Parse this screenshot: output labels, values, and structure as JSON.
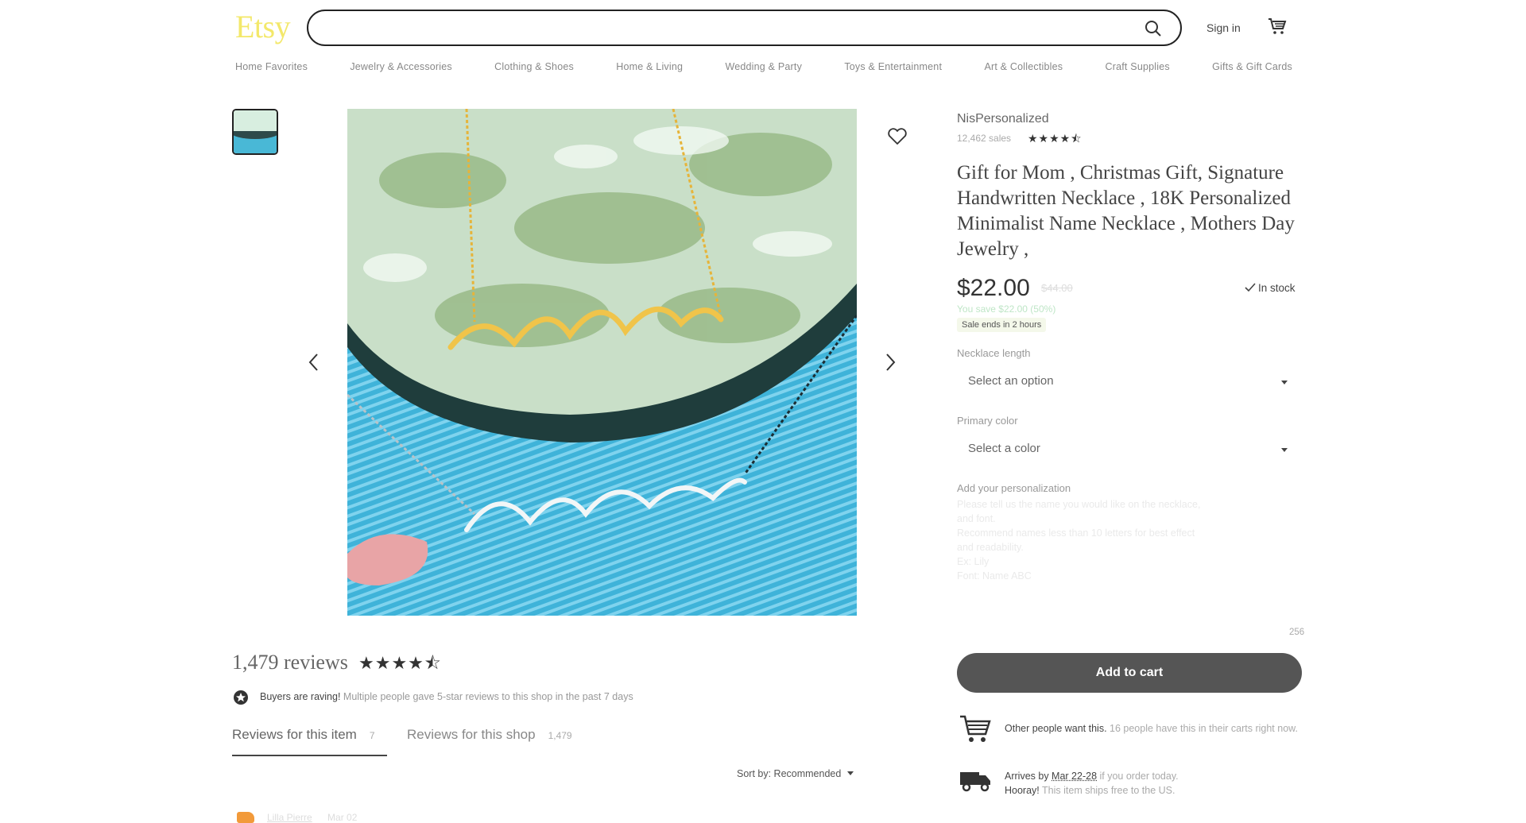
{
  "header": {
    "logo": "Etsy",
    "search_placeholder": "",
    "sign_in": "Sign in",
    "nav": [
      "Home Favorites",
      "Jewelry & Accessories",
      "Clothing & Shoes",
      "Home & Living",
      "Wedding & Party",
      "Toys & Entertainment",
      "Art & Collectibles",
      "Craft Supplies",
      "Gifts & Gift Cards"
    ]
  },
  "listing": {
    "shop_name": "NisPersonalized",
    "sales": "12,462 sales",
    "shop_rating": "★★★★⯪",
    "title": "Gift for Mom , Christmas Gift, Signature Handwritten Necklace , 18K Personalized Minimalist Name Necklace , Mothers Day Jewelry ,",
    "price": "$22.00",
    "original_price": "$44.00",
    "stock": "In stock",
    "savings": "You save $22.00 (50%)",
    "sale_badge": "Sale ends in 2 hours",
    "option1_label": "Necklace length",
    "option1_value": "Select an option",
    "option2_label": "Primary color",
    "option2_value": "Select a color",
    "personalization_label": "Add your personalization",
    "personalization_lines": [
      "Please tell us the name you would like on the necklace,",
      "and font.",
      "Recommend names less than 10 letters for best effect",
      "and readability.",
      "Ex: Lily",
      "Font: Name ABC"
    ],
    "char_count": "256",
    "add_to_cart": "Add to cart",
    "demand_bold": "Other people want this.",
    "demand_text": " 16 people have this in their carts right now.",
    "arrives_prefix": "Arrives by ",
    "arrives_date": "Mar 22-28",
    "arrives_suffix": " if you order today.",
    "shipping_bold": "Hooray!",
    "shipping_text": " This item ships free to the US."
  },
  "reviews": {
    "count_title": "1,479 reviews",
    "stars": "★★★★⯪",
    "raving_bold": "Buyers are raving!",
    "raving_text": " Multiple people gave 5-star reviews to this shop in the past 7 days",
    "tab_item_label": "Reviews for this item",
    "tab_item_count": "7",
    "tab_shop_label": "Reviews for this shop",
    "tab_shop_count": "1,479",
    "sort_label": "Sort by: Recommended",
    "first_reviewer": "Lilla Pierre",
    "first_date": "Mar 02"
  },
  "colors": {
    "accent": "#f1641e",
    "logo": "#f3e86a",
    "button": "#555555"
  }
}
